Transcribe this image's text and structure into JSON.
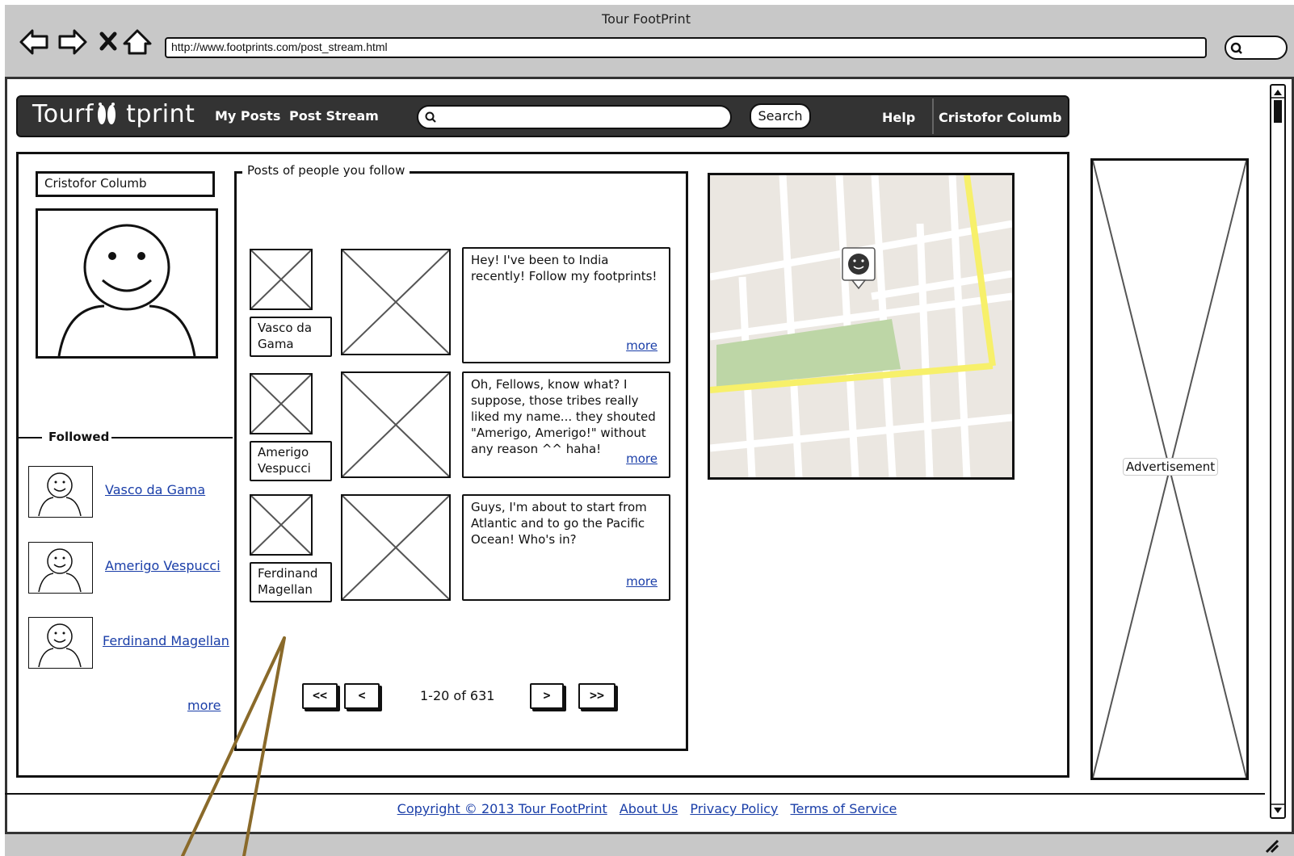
{
  "window": {
    "title": "Tour FootPrint"
  },
  "browser": {
    "url": "http://www.footprints.com/post_stream.html"
  },
  "navbar": {
    "logo": "Tourf    tprint",
    "links": [
      "My Posts",
      "Post Stream"
    ],
    "search_button": "Search",
    "help": "Help",
    "user_menu": "Cristofor Columb"
  },
  "profile": {
    "name": "Cristofor Columb"
  },
  "followed": {
    "title": "Followed",
    "people": [
      "Vasco da Gama",
      "Amerigo Vespucci",
      "Ferdinand Magellan"
    ],
    "more": "more"
  },
  "posts": {
    "title": "Posts of people you follow",
    "items": [
      {
        "author_line1": "Vasco da",
        "author_line2": "Gama",
        "text": "Hey! I've been to India recently! Follow my footprints!",
        "more": "more"
      },
      {
        "author_line1": "Amerigo",
        "author_line2": "Vespucci",
        "text": "Oh, Fellows, know what? I suppose, those tribes really liked my name... they shouted \"Amerigo, Amerigo!\" without any reason ^^ haha!",
        "more": "more"
      },
      {
        "author_line1": "Ferdinand",
        "author_line2": "Magellan",
        "text": "Guys, I'm about to start from Atlantic and to go the Pacific Ocean! Who's in?",
        "more": "more"
      }
    ],
    "pagination": {
      "first": "<<",
      "prev": "<",
      "info": "1-20 of 631",
      "next": ">",
      "last": ">>"
    }
  },
  "ad": {
    "label": "Advertisement"
  },
  "footer": {
    "copyright": "Copyright © 2013 Tour FootPrint",
    "links": [
      "About Us",
      "Privacy Policy",
      "Terms of Service"
    ]
  },
  "colors": {
    "link": "#1a3ea8",
    "nav_bg": "#333333",
    "map_road_major": "#f7f06a",
    "map_park": "#bdd6a6",
    "chrome": "#c8c8c8"
  }
}
